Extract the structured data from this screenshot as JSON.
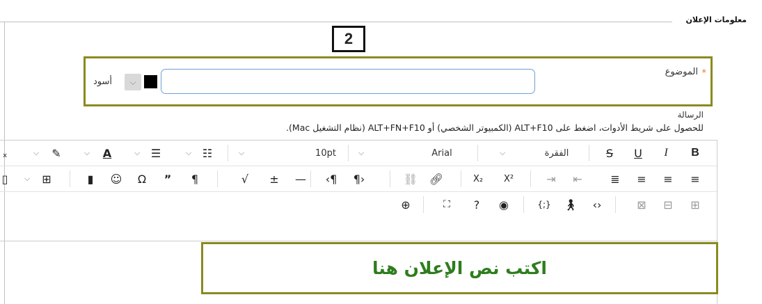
{
  "section": {
    "legend": "معلومات الإعلان"
  },
  "step_marker": "2",
  "subject": {
    "required_mark": "*",
    "label": "الموضوع",
    "value": ""
  },
  "color_picker": {
    "color": "#000000",
    "dropdown_icon": "chevron-down-icon",
    "name": "أسود"
  },
  "message": {
    "label": "الرسالة",
    "toolbar_hint": "للحصول على شريط الأدوات، اضغط على ALT+F10 (الكمبيوتر الشخصي) أو ALT+FN+F10 (نظام التشغيل Mac)."
  },
  "toolbar": {
    "paragraph_format": "الفقرة",
    "font_family": "Arial",
    "font_size": "10pt",
    "bold": "B",
    "italic": "I",
    "underline": "U",
    "strikethrough": "S",
    "text_color_letter": "A",
    "subscript": "X₂",
    "superscript": "X²"
  },
  "editor": {
    "placeholder_annotation": "اكتب نص الإعلان هنا"
  },
  "colors": {
    "olive": "#8a8a1f",
    "accent_green": "#2e7d1e",
    "required": "#e67e22",
    "input_border": "#6fa0d6"
  }
}
